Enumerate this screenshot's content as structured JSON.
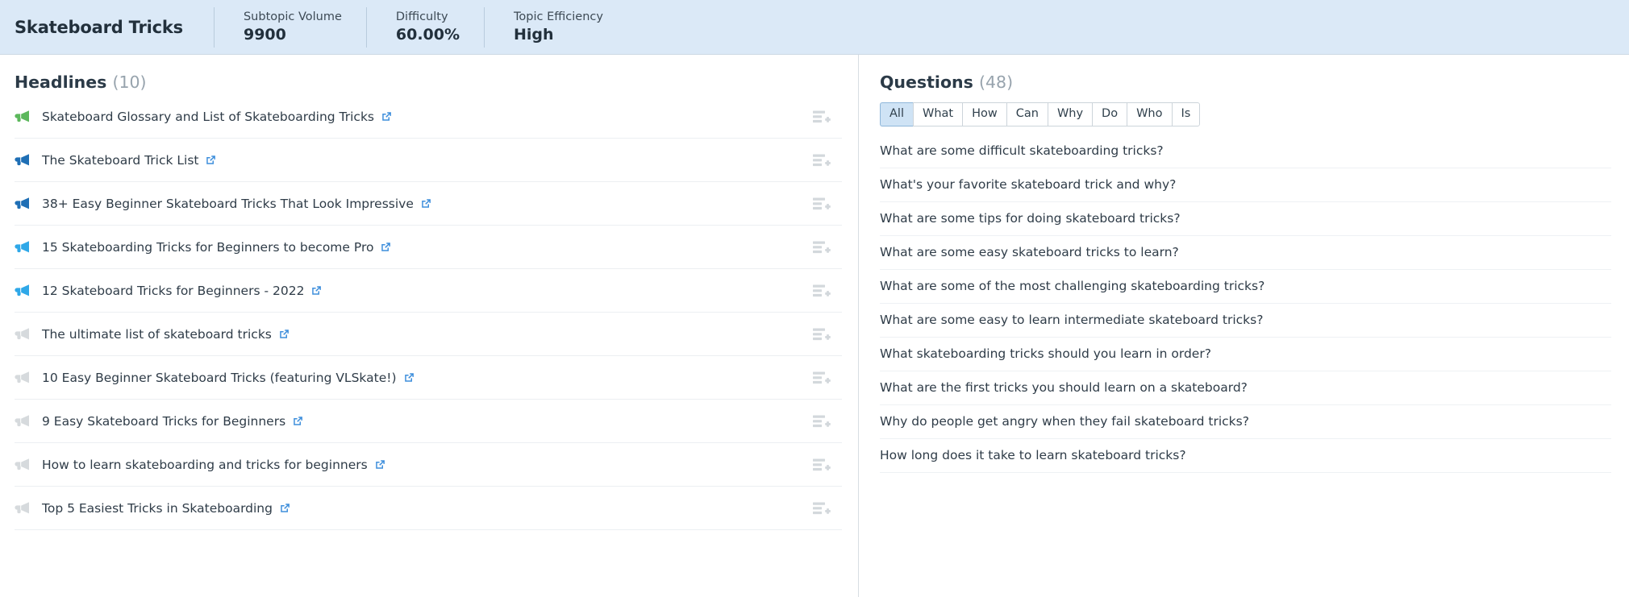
{
  "header": {
    "topic_title": "Skateboard Tricks",
    "metrics": [
      {
        "label": "Subtopic Volume",
        "value": "9900"
      },
      {
        "label": "Difficulty",
        "value": "60.00%"
      },
      {
        "label": "Topic Efficiency",
        "value": "High"
      }
    ]
  },
  "headlines_panel": {
    "title": "Headlines",
    "count": "(10)",
    "add_icon_name": "add-to-list-icon",
    "items": [
      {
        "text": "Skateboard Glossary and List of Skateboarding Tricks",
        "icon": "megaphone-icon",
        "icon_color": "#5cb85c"
      },
      {
        "text": "The Skateboard Trick List",
        "icon": "megaphone-icon",
        "icon_color": "#1f6fb5"
      },
      {
        "text": "38+ Easy Beginner Skateboard Tricks That Look Impressive",
        "icon": "megaphone-icon",
        "icon_color": "#1f6fb5"
      },
      {
        "text": "15 Skateboarding Tricks for Beginners to become Pro",
        "icon": "megaphone-icon",
        "icon_color": "#2fa8e8"
      },
      {
        "text": "12 Skateboard Tricks for Beginners - 2022",
        "icon": "megaphone-icon",
        "icon_color": "#2fa8e8"
      },
      {
        "text": "The ultimate list of skateboard tricks",
        "icon": "megaphone-icon",
        "icon_color": "#d6dadd"
      },
      {
        "text": "10 Easy Beginner Skateboard Tricks (featuring VLSkate!)",
        "icon": "megaphone-icon",
        "icon_color": "#d6dadd"
      },
      {
        "text": "9 Easy Skateboard Tricks for Beginners",
        "icon": "megaphone-icon",
        "icon_color": "#d6dadd"
      },
      {
        "text": "How to learn skateboarding and tricks for beginners",
        "icon": "megaphone-icon",
        "icon_color": "#d6dadd"
      },
      {
        "text": "Top 5 Easiest Tricks in Skateboarding",
        "icon": "megaphone-icon",
        "icon_color": "#d6dadd"
      }
    ]
  },
  "questions_panel": {
    "title": "Questions",
    "count": "(48)",
    "filters": [
      {
        "label": "All",
        "active": true
      },
      {
        "label": "What",
        "active": false
      },
      {
        "label": "How",
        "active": false
      },
      {
        "label": "Can",
        "active": false
      },
      {
        "label": "Why",
        "active": false
      },
      {
        "label": "Do",
        "active": false
      },
      {
        "label": "Who",
        "active": false
      },
      {
        "label": "Is",
        "active": false
      }
    ],
    "items": [
      {
        "text": "What are some difficult skateboarding tricks?"
      },
      {
        "text": "What's your favorite skateboard trick and why?"
      },
      {
        "text": "What are some tips for doing skateboard tricks?"
      },
      {
        "text": "What are some easy skateboard tricks to learn?"
      },
      {
        "text": "What are some of the most challenging skateboarding tricks?"
      },
      {
        "text": "What are some easy to learn intermediate skateboard tricks?"
      },
      {
        "text": "What skateboarding tricks should you learn in order?"
      },
      {
        "text": "What are the first tricks you should learn on a skateboard?"
      },
      {
        "text": "Why do people get angry when they fail skateboard tricks?"
      },
      {
        "text": "How long does it take to learn skateboard tricks?"
      }
    ]
  },
  "colors": {
    "header_band": "#dbe9f7",
    "chip_active": "#cfe3f5",
    "link_blue": "#3f8fdc",
    "text_dark": "#2f3c48"
  }
}
